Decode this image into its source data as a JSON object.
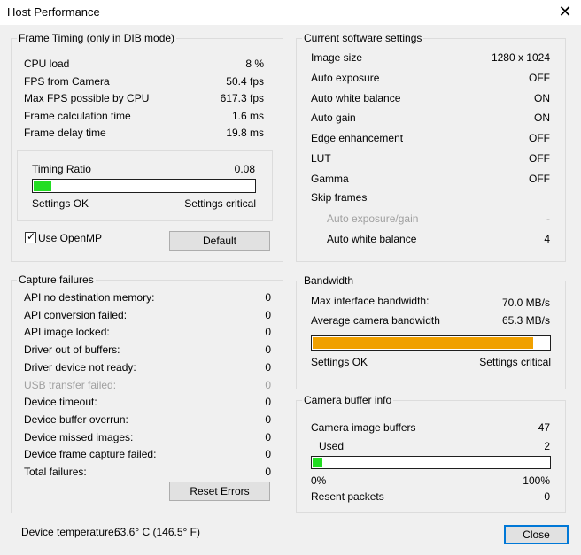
{
  "window": {
    "title": "Host Performance",
    "close_glyph": "✕"
  },
  "frame_timing": {
    "title": "Frame Timing (only in DIB mode)",
    "rows": [
      {
        "label": "CPU load",
        "value": "8 %"
      },
      {
        "label": "FPS from Camera",
        "value": "50.4 fps"
      },
      {
        "label": "Max FPS possible by CPU",
        "value": "617.3 fps"
      },
      {
        "label": "Frame calculation time",
        "value": "1.6 ms"
      },
      {
        "label": "Frame delay time",
        "value": "19.8 ms"
      }
    ],
    "timing_ratio_label": "Timing Ratio",
    "timing_ratio_value": "0.08",
    "timing_ratio_fraction": 0.08,
    "bar_color": "#22dd22",
    "settings_ok": "Settings OK",
    "settings_critical": "Settings critical",
    "use_openmp_label": "Use OpenMP",
    "use_openmp_checked": true,
    "default_button": "Default"
  },
  "software_settings": {
    "title": "Current software settings",
    "rows": [
      {
        "label": "Image size",
        "value": "1280 x 1024"
      },
      {
        "label": "Auto exposure",
        "value": "OFF"
      },
      {
        "label": "Auto white balance",
        "value": "ON"
      },
      {
        "label": "Auto gain",
        "value": "ON"
      },
      {
        "label": "Edge enhancement",
        "value": "OFF"
      },
      {
        "label": "LUT",
        "value": "OFF"
      },
      {
        "label": "Gamma",
        "value": "OFF"
      }
    ],
    "skip_frames_label": "Skip frames",
    "skip_rows": [
      {
        "label": "Auto exposure/gain",
        "value": "-",
        "disabled": true
      },
      {
        "label": "Auto white balance",
        "value": "4",
        "disabled": false
      }
    ]
  },
  "capture_failures": {
    "title": "Capture failures",
    "rows": [
      {
        "label": "API no destination memory:",
        "value": "0"
      },
      {
        "label": "API conversion failed:",
        "value": "0"
      },
      {
        "label": "API image locked:",
        "value": "0"
      },
      {
        "label": "Driver out of buffers:",
        "value": "0"
      },
      {
        "label": "Driver device not ready:",
        "value": "0"
      },
      {
        "label": "USB transfer failed:",
        "value": "0",
        "disabled": true
      },
      {
        "label": "Device timeout:",
        "value": "0"
      },
      {
        "label": "Device buffer overrun:",
        "value": "0"
      },
      {
        "label": "Device missed images:",
        "value": "0"
      },
      {
        "label": "Device frame capture failed:",
        "value": "0"
      },
      {
        "label": "Total failures:",
        "value": "0"
      }
    ],
    "reset_button": "Reset Errors"
  },
  "bandwidth": {
    "title": "Bandwidth",
    "max_label": "Max interface bandwidth:",
    "max_value": "70.0 MB/s",
    "avg_label": "Average camera bandwidth",
    "avg_value": "65.3 MB/s",
    "fraction": 0.933,
    "bar_color": "#f0a000",
    "settings_ok": "Settings OK",
    "settings_critical": "Settings critical"
  },
  "camera_buffer": {
    "title": "Camera buffer info",
    "buffers_label": "Camera image buffers",
    "buffers_value": "47",
    "used_label": "Used",
    "used_value": "2",
    "fraction": 0.0426,
    "bar_color": "#22dd22",
    "min_label": "0%",
    "max_label": "100%",
    "resent_label": "Resent packets",
    "resent_value": "0"
  },
  "footer": {
    "temperature_label": "Device temperature:",
    "temperature_value": "63.6° C  (146.5° F)",
    "close_button": "Close"
  }
}
